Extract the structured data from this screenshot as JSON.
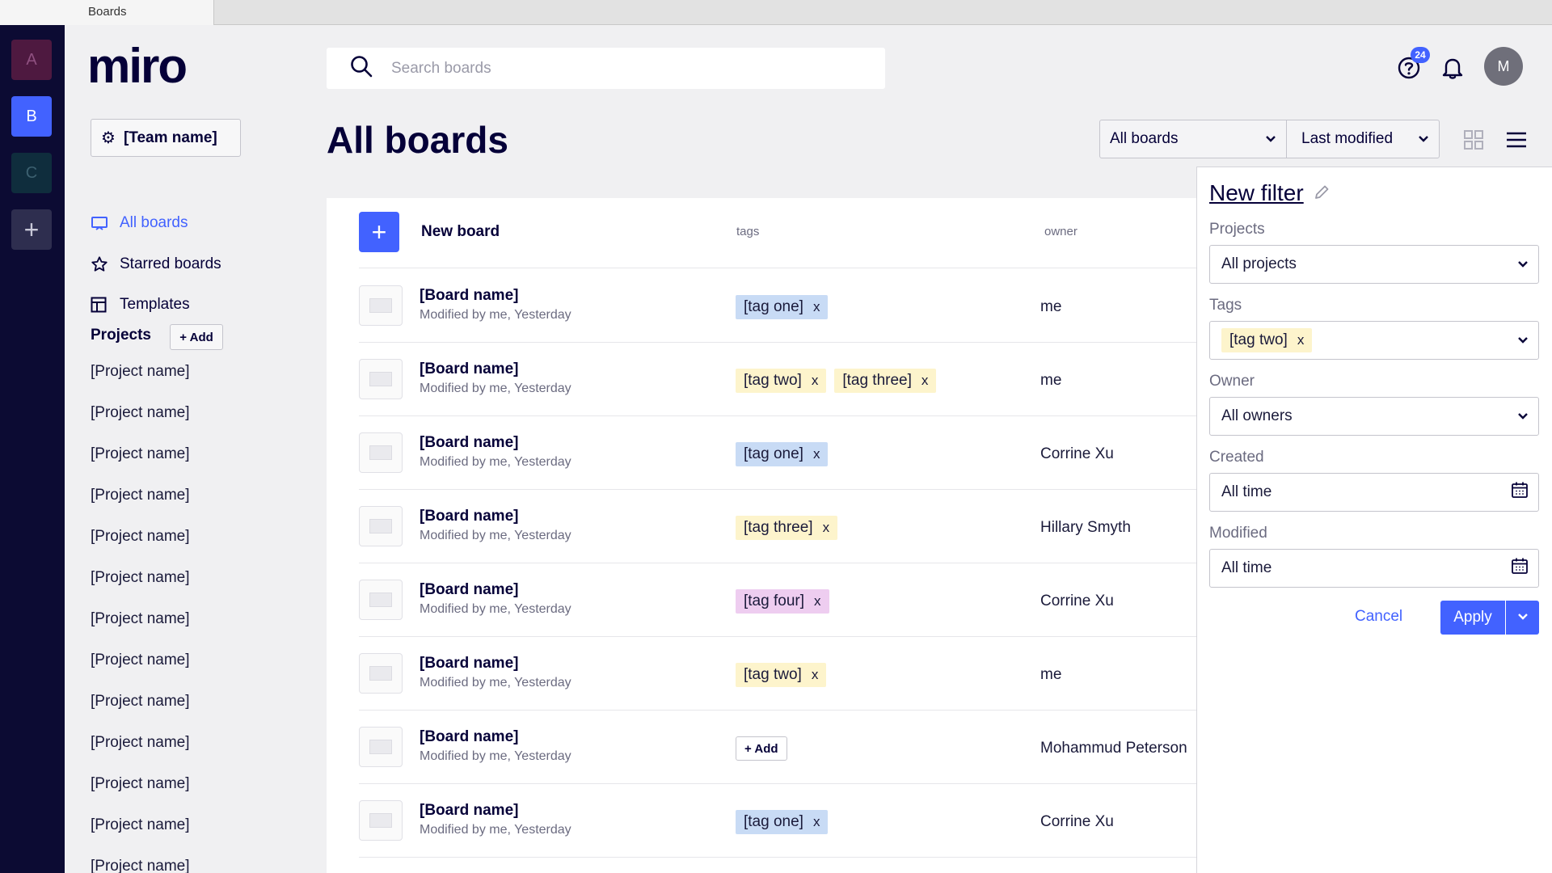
{
  "browser": {
    "tab_title": "Boards"
  },
  "rail": {
    "workspaces": [
      "A",
      "B",
      "C"
    ],
    "add_symbol": "+"
  },
  "sidebar": {
    "logo": "miro",
    "team_button": "[Team name]",
    "nav": [
      {
        "label": "All boards",
        "icon": "board-icon"
      },
      {
        "label": "Starred boards",
        "icon": "star-icon"
      },
      {
        "label": "Templates",
        "icon": "templates-icon"
      }
    ],
    "projects_heading": "Projects",
    "projects_add": "+ Add",
    "projects": [
      "[Project name]",
      "[Project name]",
      "[Project name]",
      "[Project name]",
      "[Project name]",
      "[Project name]",
      "[Project name]",
      "[Project name]",
      "[Project name]",
      "[Project name]",
      "[Project name]",
      "[Project name]",
      "[Project name]"
    ]
  },
  "header": {
    "search_placeholder": "Search boards",
    "help_badge": "24",
    "avatar_initial": "M"
  },
  "main": {
    "title": "All boards",
    "filter_select": "All boards",
    "sort_select": "Last modified",
    "new_board_label": "New board",
    "col_tags": "tags",
    "col_owner": "owner",
    "tag_add": "+ Add",
    "rows": [
      {
        "name": "[Board name]",
        "meta": "Modified by me, Yesterday",
        "tags": [
          {
            "label": "[tag one]",
            "kind": "one"
          }
        ],
        "owner": "me"
      },
      {
        "name": "[Board name]",
        "meta": "Modified by me, Yesterday",
        "tags": [
          {
            "label": "[tag two]",
            "kind": "two"
          },
          {
            "label": "[tag three]",
            "kind": "three"
          }
        ],
        "owner": "me"
      },
      {
        "name": "[Board name]",
        "meta": "Modified by me, Yesterday",
        "tags": [
          {
            "label": "[tag one]",
            "kind": "one"
          }
        ],
        "owner": "Corrine Xu"
      },
      {
        "name": "[Board name]",
        "meta": "Modified by me, Yesterday",
        "tags": [
          {
            "label": "[tag three]",
            "kind": "three"
          }
        ],
        "owner": "Hillary Smyth"
      },
      {
        "name": "[Board name]",
        "meta": "Modified by me, Yesterday",
        "tags": [
          {
            "label": "[tag four]",
            "kind": "four"
          }
        ],
        "owner": "Corrine Xu"
      },
      {
        "name": "[Board name]",
        "meta": "Modified by me, Yesterday",
        "tags": [
          {
            "label": "[tag two]",
            "kind": "two"
          }
        ],
        "owner": "me"
      },
      {
        "name": "[Board name]",
        "meta": "Modified by me, Yesterday",
        "tags": [],
        "owner": "Mohammud Peterson"
      },
      {
        "name": "[Board name]",
        "meta": "Modified by me, Yesterday",
        "tags": [
          {
            "label": "[tag one]",
            "kind": "one"
          }
        ],
        "owner": "Corrine Xu"
      }
    ]
  },
  "filter_panel": {
    "title": "New filter",
    "projects_label": "Projects",
    "projects_value": "All projects",
    "tags_label": "Tags",
    "tags_value": "[tag two]",
    "owner_label": "Owner",
    "owner_value": "All owners",
    "created_label": "Created",
    "created_value": "All time",
    "modified_label": "Modified",
    "modified_value": "All time",
    "cancel": "Cancel",
    "apply": "Apply"
  },
  "colors": {
    "accent": "#4262ff",
    "navy": "#050038",
    "tag_one": "#c8dbf5",
    "tag_two": "#fdf4cc",
    "tag_four": "#eecdf0"
  },
  "tag_remove_symbol": "x"
}
